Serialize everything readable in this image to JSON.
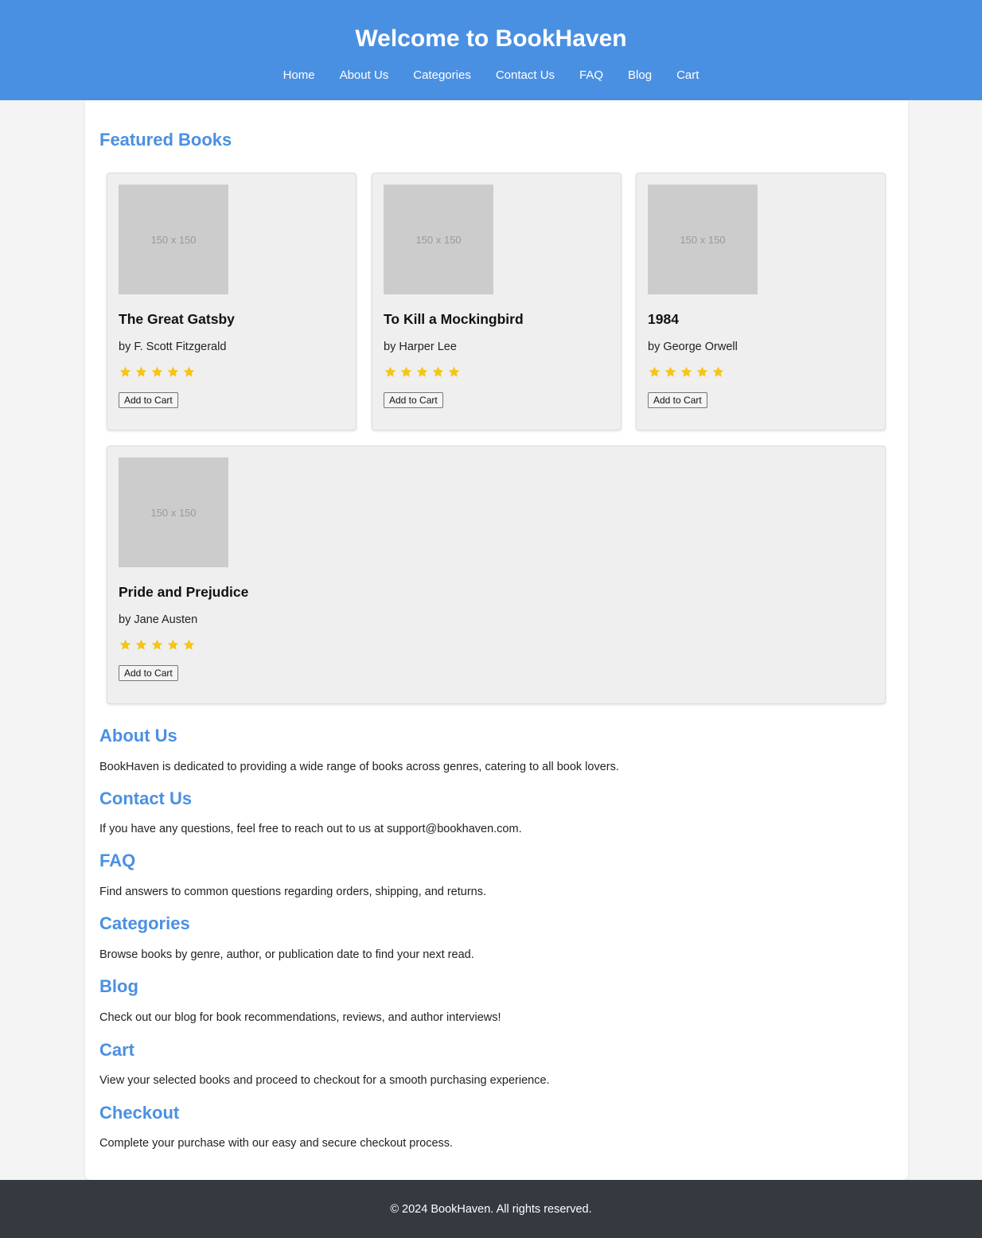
{
  "header": {
    "title": "Welcome to BookHaven",
    "nav": [
      "Home",
      "About Us",
      "Categories",
      "Contact Us",
      "FAQ",
      "Blog",
      "Cart"
    ]
  },
  "featured": {
    "heading": "Featured Books",
    "books": [
      {
        "cover": "150 x 150",
        "title": "The Great Gatsby",
        "author": "by F. Scott Fitzgerald",
        "rating": 5,
        "button": "Add to Cart"
      },
      {
        "cover": "150 x 150",
        "title": "To Kill a Mockingbird",
        "author": "by Harper Lee",
        "rating": 5,
        "button": "Add to Cart"
      },
      {
        "cover": "150 x 150",
        "title": "1984",
        "author": "by George Orwell",
        "rating": 5,
        "button": "Add to Cart"
      },
      {
        "cover": "150 x 150",
        "title": "Pride and Prejudice",
        "author": "by Jane Austen",
        "rating": 5,
        "button": "Add to Cart"
      }
    ]
  },
  "sections": [
    {
      "heading": "About Us",
      "text": "BookHaven is dedicated to providing a wide range of books across genres, catering to all book lovers."
    },
    {
      "heading": "Contact Us",
      "text": "If you have any questions, feel free to reach out to us at support@bookhaven.com."
    },
    {
      "heading": "FAQ",
      "text": "Find answers to common questions regarding orders, shipping, and returns."
    },
    {
      "heading": "Categories",
      "text": "Browse books by genre, author, or publication date to find your next read."
    },
    {
      "heading": "Blog",
      "text": "Check out our blog for book recommendations, reviews, and author interviews!"
    },
    {
      "heading": "Cart",
      "text": "View your selected books and proceed to checkout for a smooth purchasing experience."
    },
    {
      "heading": "Checkout",
      "text": "Complete your purchase with our easy and secure checkout process."
    }
  ],
  "footer": {
    "text": "© 2024 BookHaven. All rights reserved."
  },
  "colors": {
    "accent": "#4a90e2",
    "star": "#f5c518",
    "footer_bg": "#343a40"
  }
}
